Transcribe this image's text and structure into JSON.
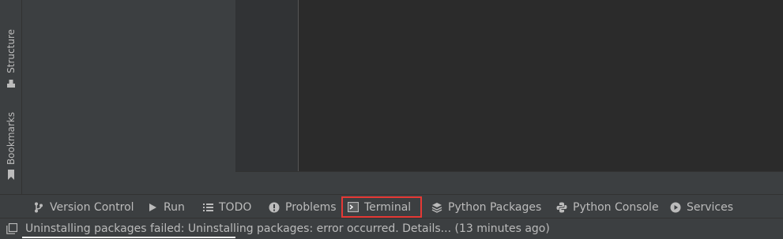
{
  "side_tabs": {
    "structure": {
      "label": "Structure",
      "icon": "structure-icon"
    },
    "bookmarks": {
      "label": "Bookmarks",
      "icon": "bookmark-icon"
    }
  },
  "tool_window_bar": {
    "tabs": [
      {
        "label": "Version Control",
        "icon": "version-control-icon"
      },
      {
        "label": "Run",
        "icon": "run-icon"
      },
      {
        "label": "TODO",
        "icon": "todo-icon"
      },
      {
        "label": "Problems",
        "icon": "problems-icon"
      },
      {
        "label": "Terminal",
        "icon": "terminal-icon",
        "highlighted": true
      },
      {
        "label": "Python Packages",
        "icon": "python-packages-icon"
      },
      {
        "label": "Python Console",
        "icon": "python-console-icon"
      },
      {
        "label": "Services",
        "icon": "services-icon"
      }
    ]
  },
  "status_bar": {
    "message": "Uninstalling packages failed: Uninstalling packages: error occurred. Details... (13 minutes ago)",
    "icon": "toggle-tool-windows-icon"
  },
  "colors": {
    "highlight_border": "#e53935",
    "panel_bg": "#3c3f41",
    "editor_bg": "#2b2b2b",
    "text": "#bbbbbb"
  }
}
